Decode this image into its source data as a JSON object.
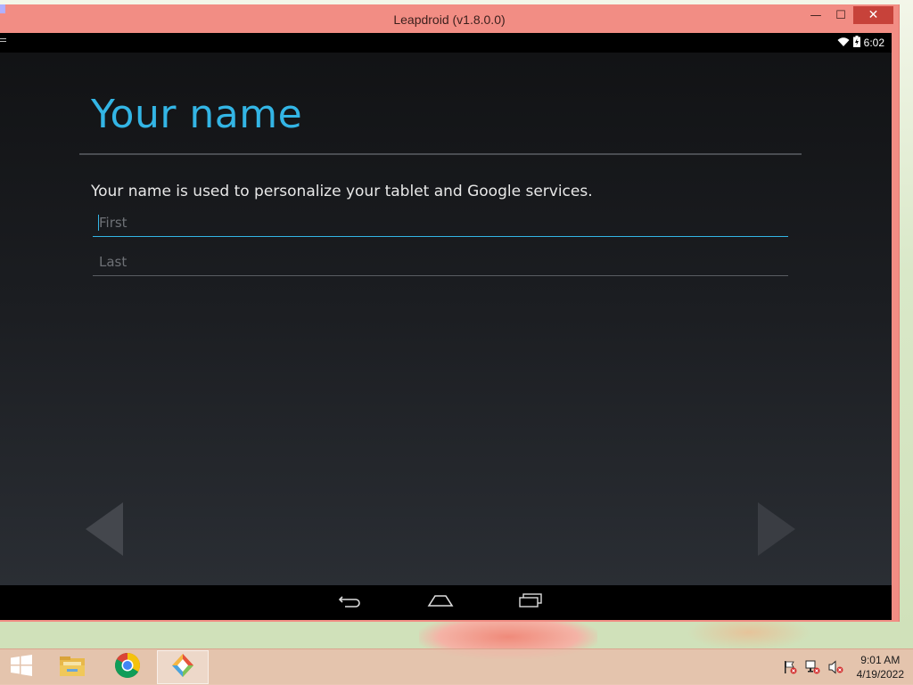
{
  "window": {
    "title": "Leapdroid (v1.8.0.0)",
    "minimize_symbol": "—",
    "maximize_symbol": "☐",
    "close_symbol": "✕"
  },
  "statusbar": {
    "time": "6:02",
    "icons": [
      "wifi-icon",
      "battery-icon"
    ]
  },
  "setup": {
    "title": "Your name",
    "description": "Your name is used to personalize your tablet and Google services.",
    "first_placeholder": "First",
    "last_placeholder": "Last",
    "first_value": "",
    "last_value": ""
  },
  "navbar": {
    "buttons": [
      "back-icon",
      "home-icon",
      "recent-apps-icon"
    ]
  },
  "taskbar": {
    "items": [
      "windows-start-icon",
      "file-explorer-icon",
      "chrome-icon",
      "leapdroid-icon"
    ],
    "active_item": "leapdroid-icon",
    "tray_icons": [
      "action-center-flag-icon",
      "network-icon",
      "volume-muted-icon"
    ],
    "time": "9:01 AM",
    "date": "4/19/2022"
  },
  "colors": {
    "accent": "#33b5e5",
    "window_frame": "#f28d84",
    "close_button": "#c7423a"
  }
}
